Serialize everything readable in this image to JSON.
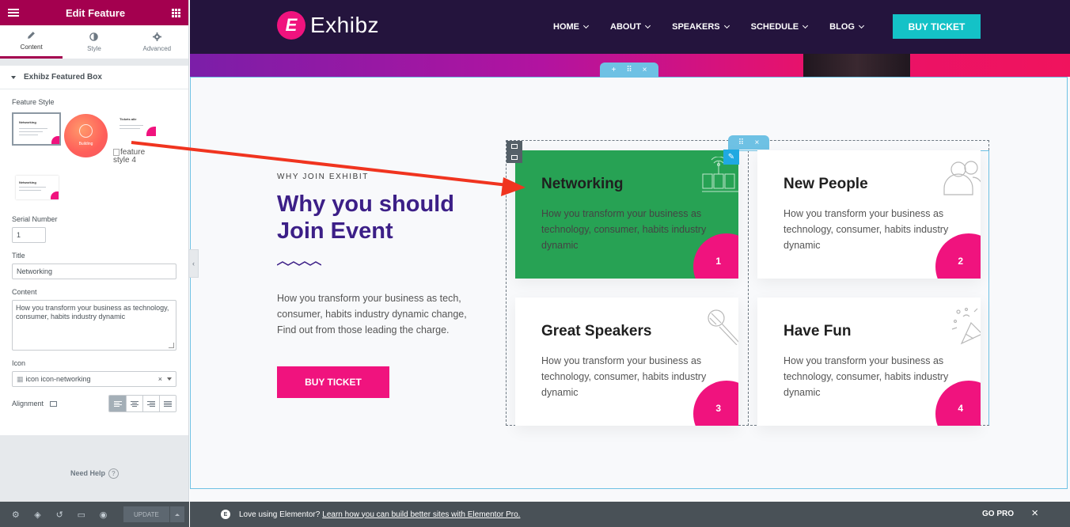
{
  "panel": {
    "header_title": "Edit Feature",
    "tabs": [
      {
        "label": "Content",
        "icon": "pencil-icon"
      },
      {
        "label": "Style",
        "icon": "half-circle-icon"
      },
      {
        "label": "Advanced",
        "icon": "gear-icon"
      }
    ],
    "section_title": "Exhibz Featured Box",
    "feature_style_label": "Feature Style",
    "style_thumbs": {
      "s1_title": "Networking",
      "s2_label": "Building",
      "s3_title": "Tickets aile",
      "s4_alt": "feature style 4",
      "s5_title": "Networking"
    },
    "serial_label": "Serial Number",
    "serial_value": "1",
    "title_label": "Title",
    "title_value": "Networking",
    "content_label": "Content",
    "content_value": "How you transform your business as technology, consumer, habits industry dynamic",
    "icon_label": "Icon",
    "icon_value": "icon icon-networking",
    "alignment_label": "Alignment",
    "need_help": "Need Help",
    "update_label": "UPDATE"
  },
  "site": {
    "logo_letter": "E",
    "logo_text": "Exhibz",
    "nav": [
      "HOME",
      "ABOUT",
      "SPEAKERS",
      "SCHEDULE",
      "BLOG"
    ],
    "nav_buy": "BUY TICKET",
    "eyebrow": "WHY JOIN EXHIBIT",
    "heading": "Why you should Join Event",
    "body": "How you transform your business as tech, consumer, habits industry dynamic change, Find out from those leading the charge.",
    "buy": "BUY TICKET",
    "cards": [
      {
        "title": "Networking",
        "text": "How you transform your business as technology, consumer, habits industry dynamic",
        "num": "1",
        "icon": "networking-icon"
      },
      {
        "title": "New People",
        "text": "How you transform your business as technology, consumer, habits industry dynamic",
        "num": "2",
        "icon": "people-icon"
      },
      {
        "title": "Great Speakers",
        "text": "How you transform your business as technology, consumer, habits industry dynamic",
        "num": "3",
        "icon": "microphone-icon"
      },
      {
        "title": "Have Fun",
        "text": "How you transform your business as technology, consumer, habits industry dynamic",
        "num": "4",
        "icon": "party-popper-icon"
      }
    ]
  },
  "bottom_bar": {
    "message": "Love using Elementor?",
    "link": "Learn how you can build better sites with Elementor Pro.",
    "go_pro": "GO PRO"
  },
  "colors": {
    "brand": "#a4004f",
    "accent_pink": "#f0137e",
    "teal": "#14c2c7",
    "heading_purple": "#3c1f87",
    "green_card": "#27a254",
    "arrow_red": "#f0341f"
  }
}
